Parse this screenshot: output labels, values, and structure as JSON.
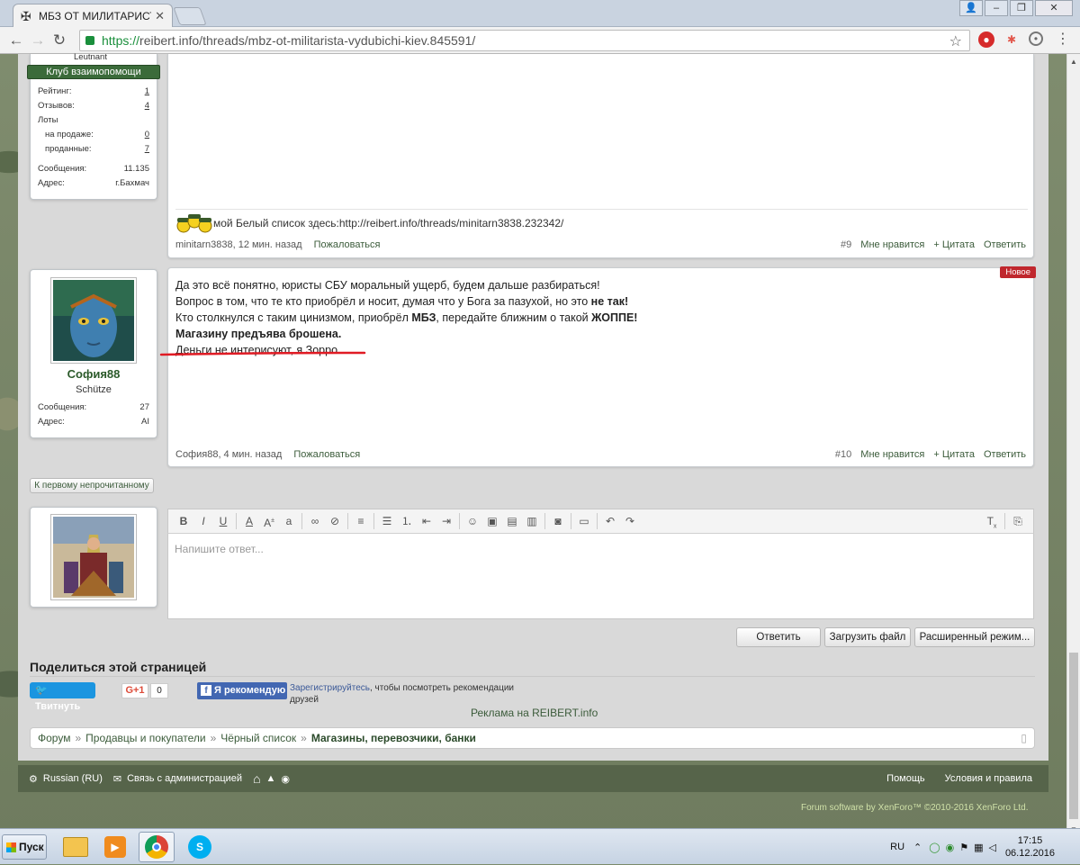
{
  "browser": {
    "tab_title": "МБЗ ОТ МИЛИТАРИСТА",
    "url_scheme": "https://",
    "url_rest": "reibert.info/threads/mbz-ot-militarista-vydubichi-kiev.845591/"
  },
  "user1": {
    "rank": "Leutnant",
    "club": "Клуб взаимопомощи",
    "stats": [
      {
        "label": "Рейтинг:",
        "value": "1"
      },
      {
        "label": "Отзывов:",
        "value": "4"
      },
      {
        "label": "Лоты",
        "value": ""
      },
      {
        "label": "на продаже:",
        "value": "0"
      },
      {
        "label": "проданные:",
        "value": "7"
      },
      {
        "label": "Сообщения:",
        "value": "11.135"
      },
      {
        "label": "Адрес:",
        "value": "г.Бахмач"
      }
    ]
  },
  "post9": {
    "signature": "мой Белый список здесь:http://reibert.info/threads/minitarn3838.232342/",
    "author_time": "minitarn3838, 12 мин. назад",
    "report": "Пожаловаться",
    "number": "#9",
    "like": "Мне нравится",
    "quote": "+ Цитата",
    "reply": "Ответить"
  },
  "user2": {
    "name": "София88",
    "rank": "Schütze",
    "stats": [
      {
        "label": "Сообщения:",
        "value": "27"
      },
      {
        "label": "Адрес:",
        "value": "AI"
      }
    ]
  },
  "post10": {
    "badge": "Новое",
    "line1": "Да это всё понятно, юристы СБУ моральный ущерб, будем дальше разбираться!",
    "line2_a": "Вопрос в том, что те кто приобрёл и носит, думая что у Бога за пазухой, но это ",
    "line2_b": "не так!",
    "line3_a": "Кто столкнулся с таким цинизмом, приобрёл ",
    "line3_b": "МБЗ",
    "line3_c": ", передайте ближним о такой ",
    "line3_d": "ЖОППЕ!",
    "line4": "Магазину предъява брошена.",
    "line5": "Деньги не интерисуют, я Зорро.",
    "author_time": "София88, 4 мин. назад",
    "report": "Пожаловаться",
    "number": "#10",
    "like": "Мне нравится",
    "quote": "+ Цитата",
    "reply": "Ответить"
  },
  "unread_button": "К первому непрочитанному",
  "editor": {
    "placeholder": "Напишите ответ...",
    "reply_btn": "Ответить",
    "upload_btn": "Загрузить файл",
    "advanced_btn": "Расширенный режим..."
  },
  "share": {
    "title": "Поделиться этой страницей",
    "tweet": "Твитнуть",
    "gplus": "G+1",
    "gplus_count": "0",
    "fb_recommend": "Я рекомендую",
    "fb_register": "Зарегистрируйтесь",
    "fb_text": ", чтобы посмотреть рекомендации друзей",
    "ad": "Реклама на REIBERT.info"
  },
  "breadcrumbs": [
    "Форум",
    "Продавцы и покупатели",
    "Чёрный список"
  ],
  "breadcrumb_current": "Магазины, перевозчики, банки",
  "footer": {
    "language": "Russian (RU)",
    "contact": "Связь с администрацией",
    "help": "Помощь",
    "terms": "Условия и правила",
    "copyright": "Forum software by XenForo™ ©2010-2016 XenForo Ltd."
  },
  "taskbar": {
    "start": "Пуск",
    "lang": "RU",
    "time": "17:15",
    "date": "06.12.2016"
  },
  "colors": {
    "accent_green": "#3b5b3a",
    "new_badge": "#c0272d",
    "twitter": "#1b95e0",
    "facebook": "#4267b2"
  }
}
